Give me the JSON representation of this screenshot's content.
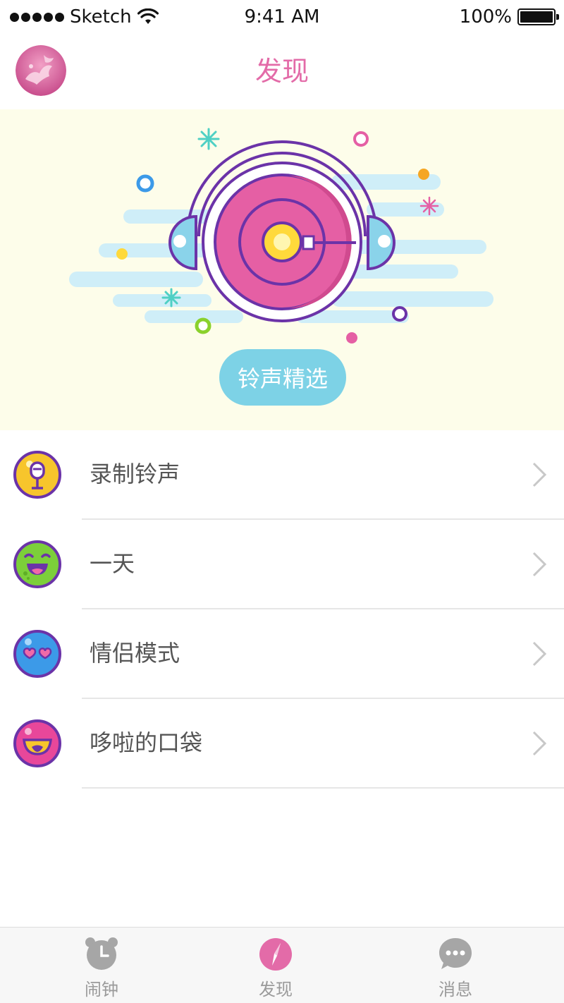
{
  "status_bar": {
    "carrier": "Sketch",
    "time": "9:41 AM",
    "battery": "100%",
    "battery_level": 1.0
  },
  "nav": {
    "title": "发现"
  },
  "banner": {
    "button_label": "铃声精选"
  },
  "list": {
    "items": [
      {
        "label": "录制铃声",
        "icon": "microphone-face-icon",
        "color": "#f7c52c"
      },
      {
        "label": "一天",
        "icon": "laughing-face-icon",
        "color": "#7ccf3a"
      },
      {
        "label": "情侣模式",
        "icon": "heart-eyes-face-icon",
        "color": "#3c9ae8"
      },
      {
        "label": "哆啦的口袋",
        "icon": "smile-face-icon",
        "color": "#e8479a"
      }
    ]
  },
  "tab_bar": {
    "tabs": [
      {
        "label": "闹钟",
        "icon": "alarm-clock-icon",
        "active": false
      },
      {
        "label": "发现",
        "icon": "compass-icon",
        "active": true
      },
      {
        "label": "消息",
        "icon": "chat-bubble-icon",
        "active": false
      }
    ]
  },
  "colors": {
    "accent": "#e36ba8",
    "banner_bg": "#fdfdea",
    "button_bg": "#7dd2e6",
    "purple": "#6b33a8"
  }
}
